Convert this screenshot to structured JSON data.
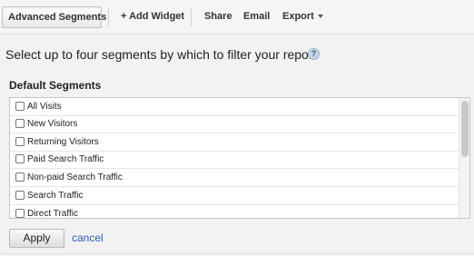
{
  "toolbar": {
    "advanced_segments": "Advanced Segments",
    "add_widget": "+ Add Widget",
    "share": "Share",
    "email": "Email",
    "export": "Export"
  },
  "instruction": "Select up to four segments by which to filter your report",
  "help_icon": {
    "symbol": "?"
  },
  "segments": {
    "header": "Default Segments",
    "items": [
      {
        "label": "All Visits",
        "checked": false
      },
      {
        "label": "New Visitors",
        "checked": false
      },
      {
        "label": "Returning Visitors",
        "checked": false
      },
      {
        "label": "Paid Search Traffic",
        "checked": false
      },
      {
        "label": "Non-paid Search Traffic",
        "checked": false
      },
      {
        "label": "Search Traffic",
        "checked": false
      },
      {
        "label": "Direct Traffic",
        "checked": false
      }
    ]
  },
  "actions": {
    "apply": "Apply",
    "cancel": "cancel"
  },
  "colors": {
    "link": "#2a5db0",
    "background": "#f2f2f2"
  }
}
